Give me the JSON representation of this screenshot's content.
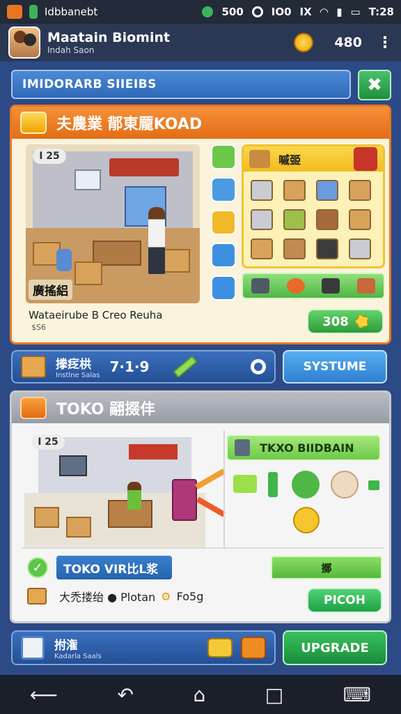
{
  "status_bar": {
    "app_label": "Idbbanebt",
    "item1": "500",
    "item2": "IO0",
    "item3": "IX",
    "time": "T:28"
  },
  "header": {
    "name": "Maatain Biomint",
    "subtitle": "Indah Saon",
    "coins": "480"
  },
  "search": {
    "label": "IMIDORARB SIIEIBS"
  },
  "panel1": {
    "title": "夫農業 鄁東龎KOAD",
    "level_badge": "I 25",
    "scene_label": "廣搖絽",
    "description": "Wataeirube B Creo Reuha",
    "description_sub": "$S6",
    "catalog_title": "嘁臦",
    "value_button": "308"
  },
  "row2": {
    "title": "搼疺栱",
    "subtitle": "Instlne Salas",
    "stat": "7·1·9",
    "button": "SYSTUME"
  },
  "panel2": {
    "title": "TOKO 翤掇仹",
    "level_badge": "I 25",
    "tag_label": "TKXO BIIDBAIN",
    "verify_label": "TOKO VIR比L浆",
    "greenbar_label": "擲",
    "plan_text": "大禿搂绐 ● Plotan",
    "plan_suffix": "Fo5g",
    "pic_button": "PICOH"
  },
  "row3": {
    "title": "拊潅",
    "subtitle": "Kadarla Saals",
    "upgrade_button": "UPGRADE"
  },
  "colors": {
    "orange": "#e8761f",
    "blue": "#2f69b8",
    "green": "#1e8f3d"
  }
}
